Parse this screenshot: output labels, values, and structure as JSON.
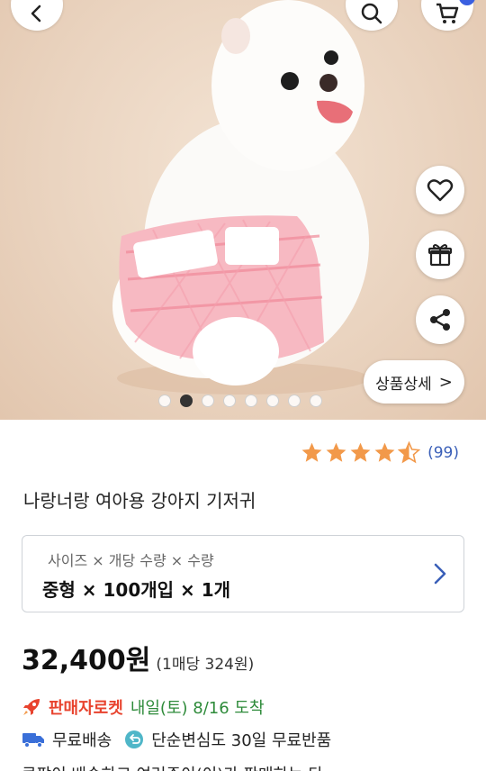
{
  "hero": {
    "image_alt": "",
    "detail_button_label": "상품상세",
    "detail_chevron": ">",
    "page_index": 2,
    "page_total": 8
  },
  "icons": {
    "back": "back-icon",
    "search": "search-icon",
    "cart": "cart-icon",
    "heart": "heart-icon",
    "gift": "gift-icon",
    "share": "share-icon"
  },
  "rating": {
    "value": 4.5,
    "max": 5,
    "count_label": "(99)",
    "star_color": "#f2994a"
  },
  "product": {
    "title": "나랑너랑 여아용 강아지 기저귀"
  },
  "option": {
    "label": "사이즈 × 개당 수량 × 수량",
    "value": "중형 × 100개입 × 1개"
  },
  "price": {
    "main": "32,400원",
    "unit": "(1매당 324원)"
  },
  "delivery": {
    "rocket_label": "판매자로켓",
    "eta": "내일(토) 8/16 도착",
    "free_shipping": "무료배송",
    "free_return": "단순변심도 30일 무료반품",
    "cut_text": "쿠팡이 배송하고 여러주이(이)가 판매하는 다"
  },
  "colors": {
    "accent_blue": "#3a5fb8",
    "rocket_red": "#e8432e",
    "eta_green": "#2e8b3a",
    "badge_blue": "#3a5fe0"
  }
}
